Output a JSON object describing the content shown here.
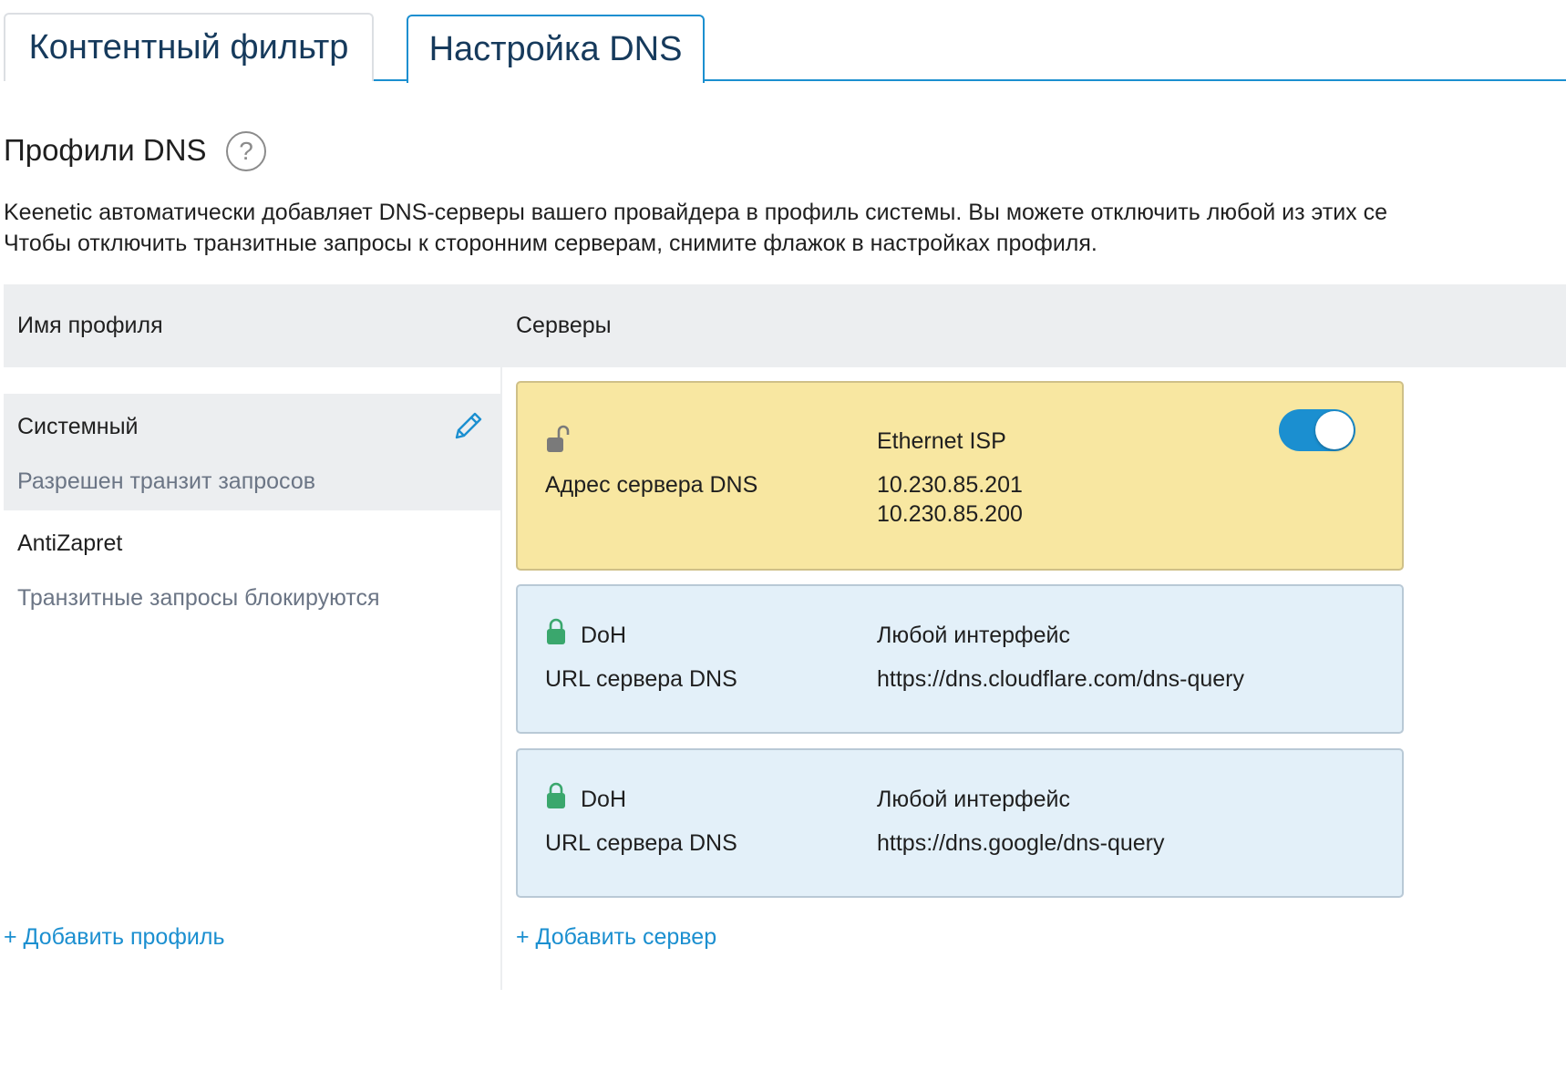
{
  "tabs": [
    {
      "label": "Контентный фильтр",
      "active": false
    },
    {
      "label": "Настройка DNS",
      "active": true
    }
  ],
  "section": {
    "title": "Профили DNS",
    "help_icon": "?",
    "description_line1": "Keenetic автоматически добавляет DNS-серверы вашего провайдера в профиль системы. Вы можете отключить любой из этих се",
    "description_line2": "Чтобы отключить транзитные запросы к сторонним серверам, снимите флажок в настройках профиля."
  },
  "table": {
    "col_profile": "Имя профиля",
    "col_servers": "Серверы"
  },
  "profiles": [
    {
      "name": "Системный",
      "status": "Разрешен транзит запросов",
      "selected": true
    },
    {
      "name": "AntiZapret",
      "status": "Транзитные запросы блокируются",
      "selected": false
    }
  ],
  "servers": [
    {
      "lock": "unlocked-lock-icon",
      "type": "",
      "interface": "Ethernet ISP",
      "address_label": "Адрес сервера DNS",
      "address_line1": "10.230.85.201",
      "address_line2": "10.230.85.200",
      "enabled": true
    },
    {
      "lock": "locked-lock-icon",
      "type": "DoH",
      "interface": "Любой интерфейс",
      "address_label": "URL сервера DNS",
      "address_line1": "https://dns.cloudflare.com/dns-query"
    },
    {
      "lock": "locked-lock-icon",
      "type": "DoH",
      "interface": "Любой интерфейс",
      "address_label": "URL сервера DNS",
      "address_line1": "https://dns.google/dns-query"
    }
  ],
  "actions": {
    "add_profile": "+ Добавить профиль",
    "add_server": "+ Добавить сервер"
  },
  "colors": {
    "accent": "#1b8fd0",
    "system_card": "#f8e7a1",
    "doh_card": "#e3f0f9",
    "lock_green": "#3aa76d",
    "lock_gray": "#7a7a7a"
  }
}
